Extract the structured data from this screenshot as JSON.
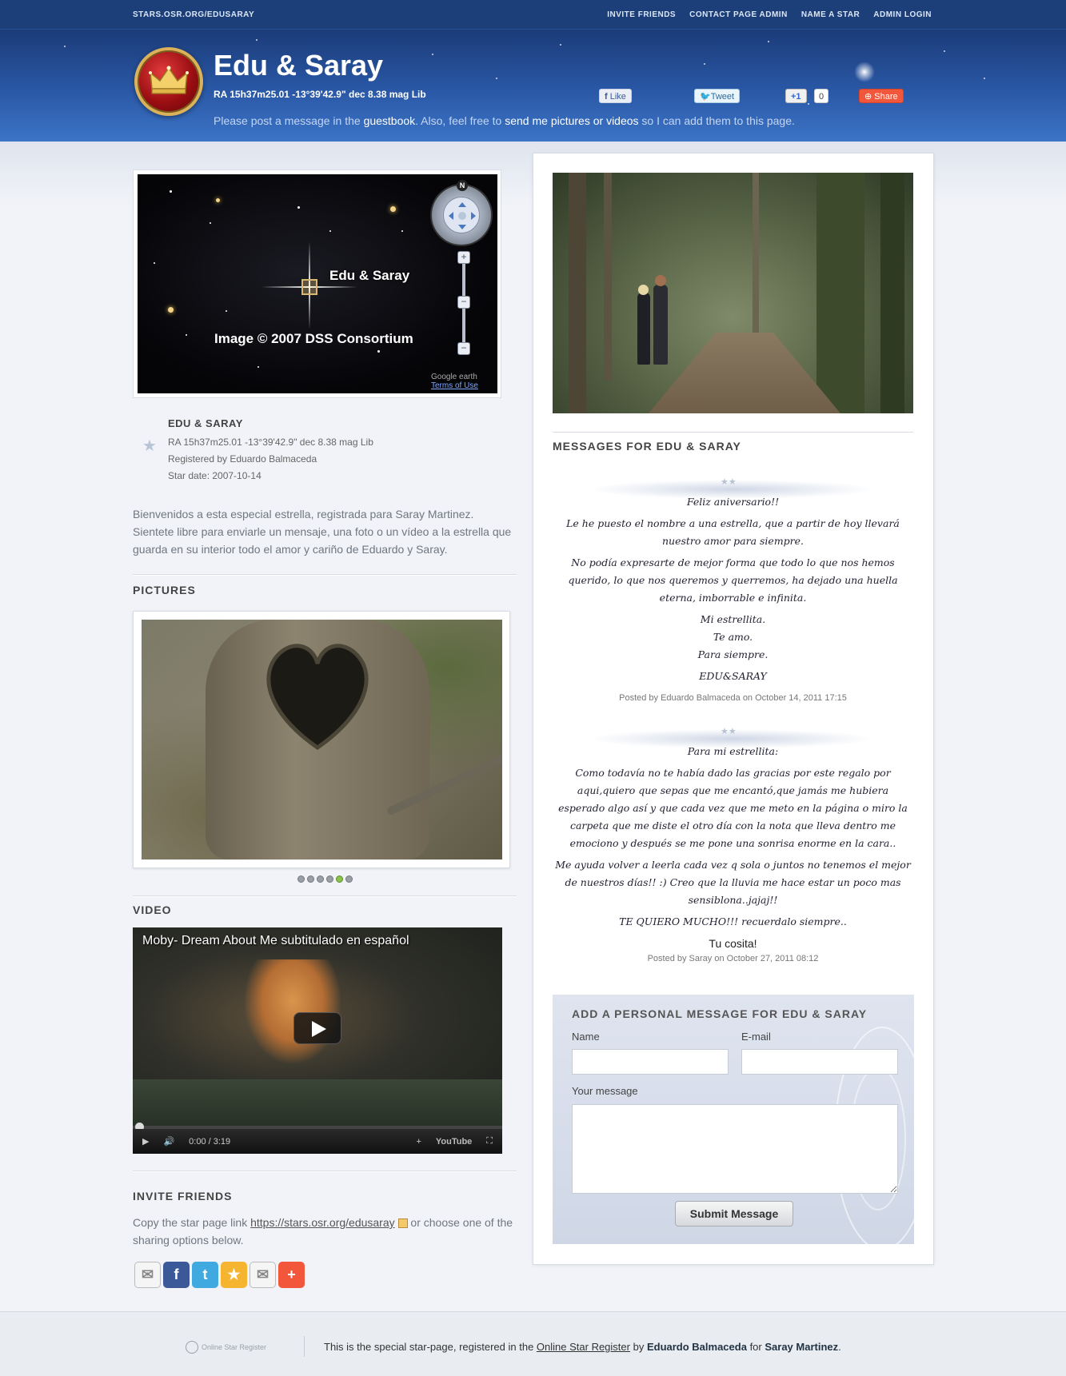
{
  "topnav": {
    "site": "STARS.OSR.ORG/EDUSARAY",
    "links": [
      "INVITE FRIENDS",
      "CONTACT PAGE ADMIN",
      "NAME A STAR",
      "ADMIN LOGIN"
    ]
  },
  "header": {
    "title": "Edu & Saray",
    "coords": "RA 15h37m25.01 -13°39'42.9\" dec 8.38 mag Lib",
    "note_prefix": "Please post a message in the ",
    "note_link1": "guestbook",
    "note_mid": ". Also, feel free to ",
    "note_link2": "send me pictures or videos",
    "note_suffix": " so I can add them to this page.",
    "social": {
      "like": "Like",
      "tweet": "Tweet",
      "plus": "+1",
      "plus_count": "0",
      "share": "Share"
    }
  },
  "sky_map": {
    "star_label": "Edu & Saray",
    "credit": "Image © 2007 DSS Consortium",
    "brand": "Google earth",
    "terms": "Terms of Use",
    "north": "N"
  },
  "star_info": {
    "name": "EDU & SARAY",
    "coords": "RA 15h37m25.01 -13°39'42.9\" dec 8.38 mag Lib",
    "registered_by": "Registered by Eduardo Balmaceda",
    "star_date": "Star date: 2007-10-14"
  },
  "intro": "Bienvenidos a esta especial estrella, registrada para Saray Martinez. Sientete libre para enviarle un mensaje, una foto o un vídeo a la estrella que guarda en su interior todo el amor y cariño de Eduardo y Saray.",
  "pictures": {
    "heading": "PICTURES",
    "slide_count": 6,
    "active_slide": 5
  },
  "video": {
    "heading": "VIDEO",
    "title": "Moby- Dream About Me subtitulado en español",
    "time": "0:00 / 3:19",
    "brand": "YouTube"
  },
  "invite": {
    "heading": "INVITE FRIENDS",
    "text_prefix": "Copy the star page link ",
    "link": "https://stars.osr.org/edusaray",
    "text_suffix": " or choose one of the sharing options below."
  },
  "messages": {
    "heading": "MESSAGES FOR EDU & SARAY",
    "list": [
      {
        "lines": [
          "Feliz aniversario!!",
          "Le he puesto el nombre a una estrella, que a partir de hoy llevará nuestro amor para siempre.",
          "No podía expresarte de mejor forma que todo lo que nos hemos querido, lo que nos queremos y querremos, ha dejado una huella eterna, imborrable e infinita.",
          "Mi estrellita.",
          "Te amo.",
          "Para siempre.",
          "EDU&SARAY"
        ],
        "meta": "Posted by Eduardo Balmaceda on October 14, 2011 17:15"
      },
      {
        "lines": [
          "Para mi estrellita:",
          "Como todavía no te había dado las gracias por este regalo por aqui,quiero que sepas que me encantó,que jamás me hubiera esperado algo así y que cada vez que me meto en la página o miro la carpeta que me diste el otro día con la nota que lleva dentro me emociono y después se me pone una sonrisa enorme en la cara..",
          "Me ayuda volver a leerla cada vez q sola o juntos no tenemos el mejor de nuestros días!! :) Creo que la lluvia me hace estar un poco mas sensiblona..jajaj!!",
          "TE QUIERO MUCHO!!! recuerdalo siempre.."
        ],
        "signature": "Tu cosita!",
        "meta": "Posted by Saray on October 27, 2011 08:12"
      }
    ]
  },
  "form": {
    "heading": "ADD A PERSONAL MESSAGE FOR EDU & SARAY",
    "name_label": "Name",
    "email_label": "E-mail",
    "message_label": "Your message",
    "submit": "Submit Message"
  },
  "footer": {
    "brand": "Online Star Register",
    "text_prefix": "This is the special star-page, registered in the ",
    "link": "Online Star Register",
    "by": " by ",
    "owner": "Eduardo Balmaceda",
    "for": " for ",
    "recipient": "Saray Martinez",
    "end": "."
  }
}
